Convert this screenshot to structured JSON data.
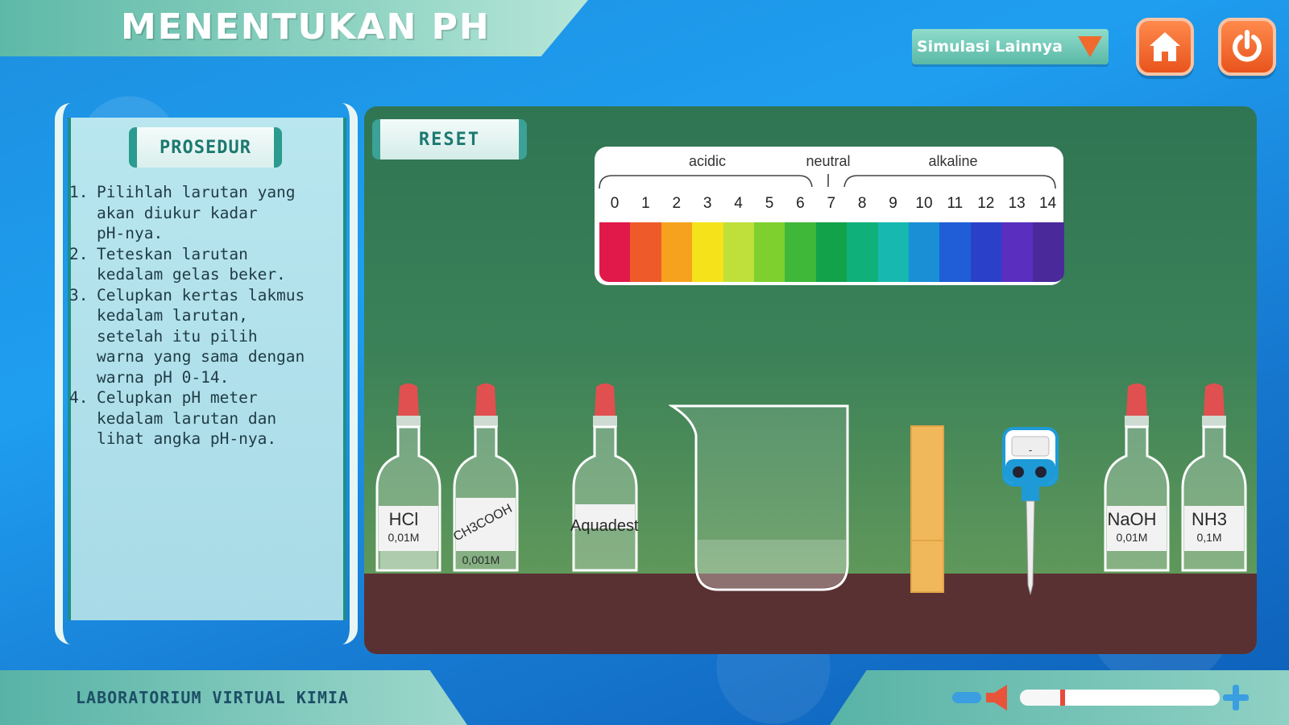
{
  "app": {
    "title": "MENENTUKAN PH",
    "footer": "LABORATORIUM VIRTUAL KIMIA"
  },
  "header": {
    "dropdown_label": "Simulasi Lainnya",
    "home_icon": "home-icon",
    "power_icon": "power-icon"
  },
  "procedure": {
    "tab_label": "PROSEDUR",
    "steps": [
      {
        "num": "1.",
        "text": "Pilihlah larutan yang\nakan diukur kadar\npH-nya."
      },
      {
        "num": "2.",
        "text": "Teteskan larutan\nkedalam gelas beker."
      },
      {
        "num": "3.",
        "text": "Celupkan kertas lakmus\nkedalam larutan,\nsetelah itu pilih\nwarna yang sama dengan\nwarna pH 0-14."
      },
      {
        "num": "4.",
        "text": "Celupkan pH meter\nkedalam larutan dan\nlihat angka pH-nya."
      }
    ]
  },
  "lab": {
    "reset_label": "RESET",
    "ph_scale": {
      "groups": [
        "acidic",
        "neutral",
        "alkaline"
      ],
      "numbers": [
        "0",
        "1",
        "2",
        "3",
        "4",
        "5",
        "6",
        "7",
        "8",
        "9",
        "10",
        "11",
        "12",
        "13",
        "14"
      ],
      "colors": [
        "#e0194a",
        "#ef5a2a",
        "#f7a21e",
        "#f5e21a",
        "#bfe03a",
        "#7ed02e",
        "#3fb83a",
        "#12a24a",
        "#10b07a",
        "#17b8b0",
        "#1a8fd6",
        "#1f5ed6",
        "#2b40c8",
        "#5a2fc0",
        "#4a2a9a"
      ]
    },
    "bottles": [
      {
        "name": "HCl",
        "conc": "0,01M"
      },
      {
        "name": "CH3COOH",
        "conc": "0,001M"
      },
      {
        "name": "Aquadest",
        "conc": ""
      },
      {
        "name": "NaOH",
        "conc": "0,01M"
      },
      {
        "name": "NH3",
        "conc": "0,1M"
      }
    ],
    "ph_meter_display": "-"
  },
  "volume": {
    "level": 0.2
  }
}
